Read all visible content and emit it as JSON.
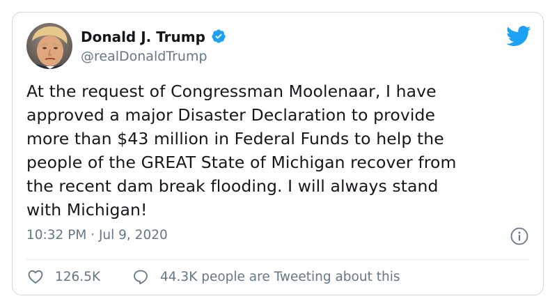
{
  "user": {
    "display_name": "Donald J. Trump",
    "handle": "@realDonaldTrump",
    "verified": true
  },
  "tweet": {
    "text": "At the request of Congressman Moolenaar, I have\napproved a major Disaster Declaration to provide\nmore than $43 million in Federal Funds to help the\npeople of the GREAT State of Michigan recover from\nthe recent dam break flooding. I will always stand\nwith Michigan!",
    "timestamp": "10:32 PM · Jul 9, 2020"
  },
  "actions": {
    "likes": "126.5K",
    "conversation": "44.3K people are Tweeting about this"
  },
  "icons": {
    "brand": "twitter-bird-icon",
    "verified": "verified-badge-icon",
    "info": "info-icon",
    "like": "heart-icon",
    "reply": "speech-bubble-icon"
  },
  "colors": {
    "brand_blue": "#1da1f2",
    "text_primary": "#14171a",
    "text_secondary": "#657786",
    "border": "#d2d6da"
  }
}
